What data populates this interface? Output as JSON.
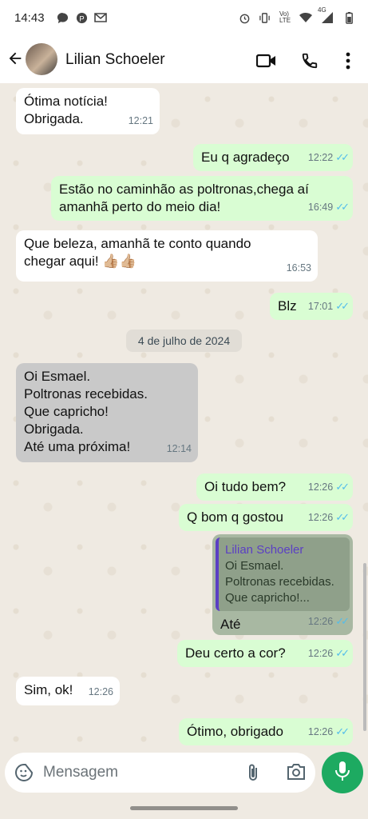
{
  "status": {
    "time": "14:43",
    "left_icons": [
      "chat-bubble-icon",
      "pinterest-icon",
      "gmail-icon"
    ],
    "right_icons": [
      "alarm-icon",
      "vibrate-icon",
      "volte-icon",
      "wifi-icon",
      "signal-icon",
      "battery-icon"
    ],
    "network": "4G"
  },
  "header": {
    "contact_name": "Lilian Schoeler",
    "actions": [
      "video-call",
      "voice-call",
      "more-options"
    ]
  },
  "chat": {
    "date_chip": "4 de julho de 2024",
    "messages": [
      {
        "dir": "in",
        "text": "Ótima notícia!\nObrigada.",
        "time": "12:21"
      },
      {
        "dir": "out",
        "text": "Eu q agradeço",
        "time": "12:22"
      },
      {
        "dir": "out",
        "text": "Estão no caminhão as poltronas,chega aí\namanhã perto do meio dia!",
        "time": "16:49"
      },
      {
        "dir": "in",
        "text": "Que beleza, amanhã te conto quando\nchegar aqui! 👍🏼👍🏼",
        "time": "16:53"
      },
      {
        "dir": "out",
        "text": "Blz",
        "time": "17:01"
      },
      {
        "dir": "in",
        "text": "Oi Esmael.\nPoltronas recebidas.\nQue capricho!\nObrigada.\nAté uma próxima!",
        "time": "12:14"
      },
      {
        "dir": "out",
        "text": "Oi tudo bem?",
        "time": "12:26"
      },
      {
        "dir": "out",
        "text": "Q bom q gostou",
        "time": "12:26"
      },
      {
        "dir": "out",
        "text": "Até",
        "time": "12:26",
        "quote_name": "Lilian Schoeler",
        "quote_text": "Oi Esmael.\nPoltronas recebidas.\nQue capricho!..."
      },
      {
        "dir": "out",
        "text": "Deu certo a cor?",
        "time": "12:26"
      },
      {
        "dir": "in",
        "text": "Sim, ok!",
        "time": "12:26"
      },
      {
        "dir": "out",
        "text": "Ótimo, obrigado",
        "time": "12:26"
      }
    ]
  },
  "composer": {
    "placeholder": "Mensagem"
  },
  "colors": {
    "outgoing": "#d9fdd3",
    "incoming": "#ffffff",
    "accent": "#1daa61",
    "read_ticks": "#53bdeb"
  }
}
